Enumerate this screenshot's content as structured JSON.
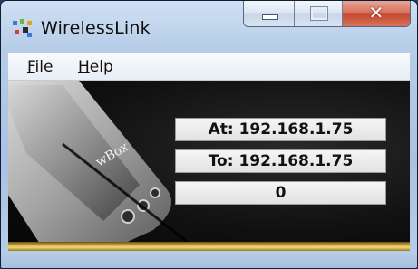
{
  "window": {
    "title": "WirelessLink"
  },
  "menu": {
    "file": "File",
    "file_rest": "ile",
    "file_key": "F",
    "help_key": "H",
    "help_rest": "elp"
  },
  "display": {
    "at_text": "At: 192.168.1.75",
    "to_text": "To: 192.168.1.75",
    "count": "0"
  },
  "device_label": "wBox",
  "colors": {
    "frame": "#b6cde8",
    "close": "#c3452b",
    "gold": "#d8b44a"
  }
}
